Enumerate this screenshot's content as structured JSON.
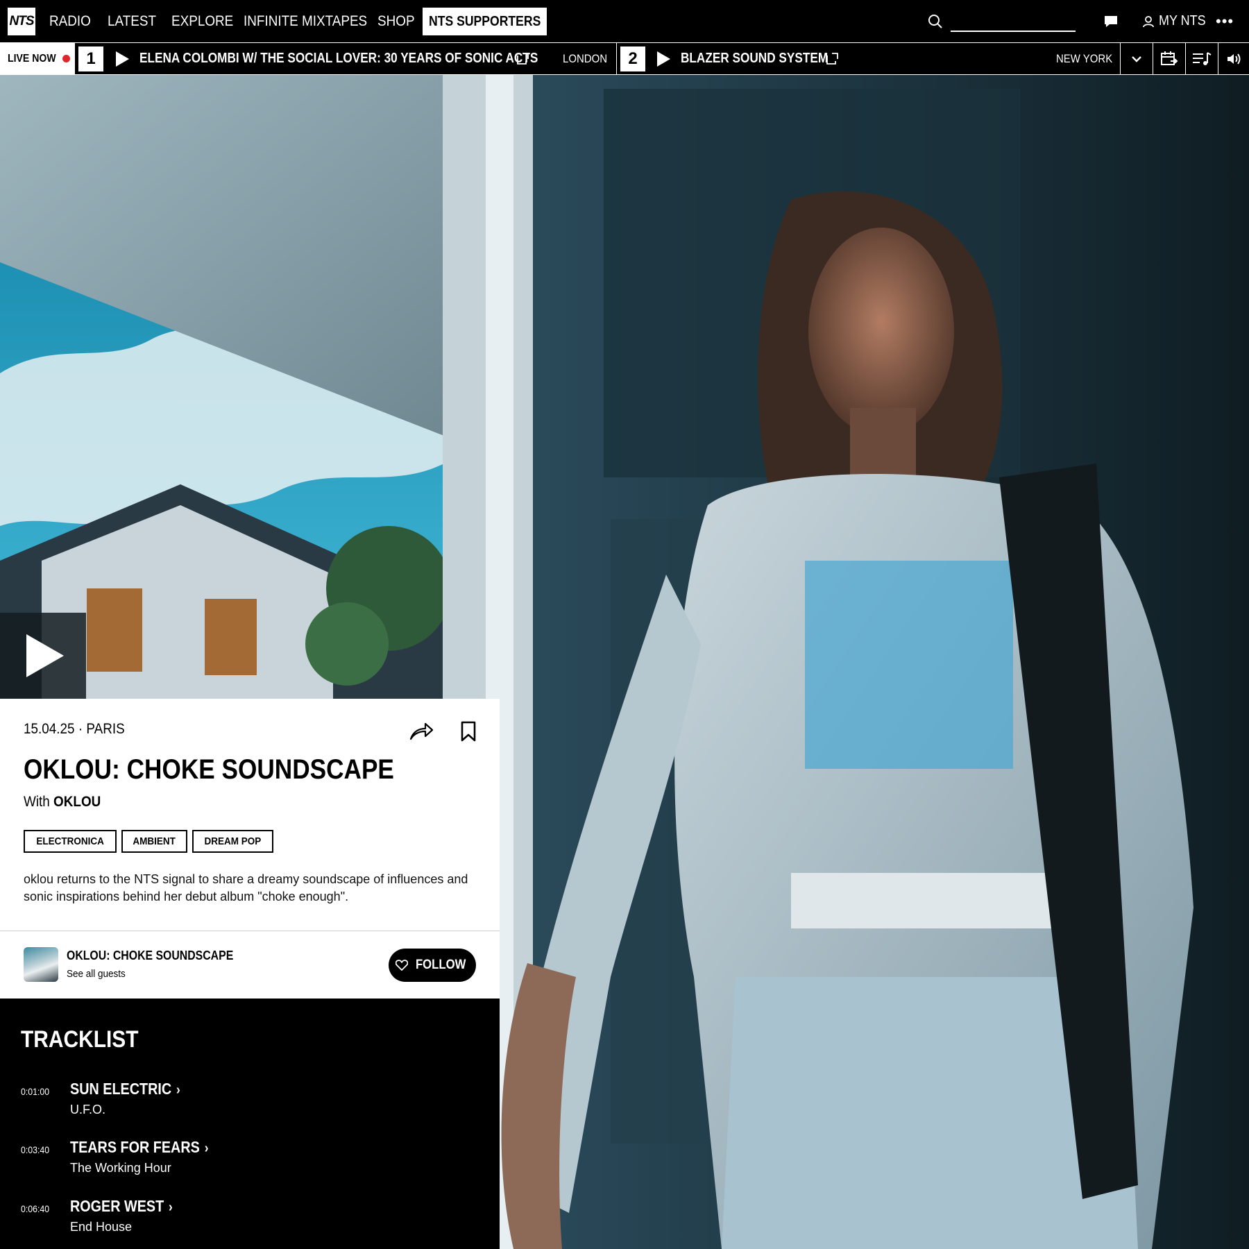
{
  "nav": {
    "logo": "NTS",
    "items": [
      "RADIO",
      "LATEST",
      "EXPLORE",
      "INFINITE MIXTAPES",
      "SHOP"
    ],
    "supporters_label": "NTS SUPPORTERS",
    "search_placeholder": "",
    "my_nts_label": "MY NTS"
  },
  "live_bar": {
    "live_label": "LIVE NOW",
    "channels": [
      {
        "number": "1",
        "title": "ELENA COLOMBI W/ THE SOCIAL LOVER: 30 YEARS OF SONIC ACTS",
        "city": "LONDON"
      },
      {
        "number": "2",
        "title": "BLAZER SOUND SYSTEM",
        "city": "NEW YORK"
      }
    ]
  },
  "episode": {
    "date": "15.04.25",
    "separator": "·",
    "location": "PARIS",
    "title": "OKLOU: CHOKE SOUNDSCAPE",
    "with_prefix": "With",
    "host": "OKLOU",
    "genres": [
      "ELECTRONICA",
      "AMBIENT",
      "DREAM POP"
    ],
    "description": "oklou returns to the NTS signal to share a dreamy soundscape of influences and sonic inspirations behind her debut album \"choke enough\"."
  },
  "host_card": {
    "name": "OKLOU: CHOKE SOUNDSCAPE",
    "sub": "See all guests",
    "follow_label": "FOLLOW"
  },
  "tracklist": {
    "title": "TRACKLIST",
    "tracks": [
      {
        "time": "0:01:00",
        "artist": "SUN ELECTRIC",
        "title": "U.F.O."
      },
      {
        "time": "0:03:40",
        "artist": "TEARS FOR FEARS",
        "title": "The Working Hour"
      },
      {
        "time": "0:06:40",
        "artist": "ROGER WEST",
        "title": "End House"
      }
    ]
  },
  "colors": {
    "live_dot": "#e0262b",
    "background": "#000000",
    "card": "#ffffff"
  },
  "icons": [
    "search-icon",
    "chat-icon",
    "user-icon",
    "more-icon",
    "external-icon",
    "chevron-down-icon",
    "schedule-icon",
    "playlist-icon",
    "volume-icon",
    "play-icon",
    "share-icon",
    "bookmark-icon",
    "heart-icon",
    "chevron-right-icon"
  ]
}
